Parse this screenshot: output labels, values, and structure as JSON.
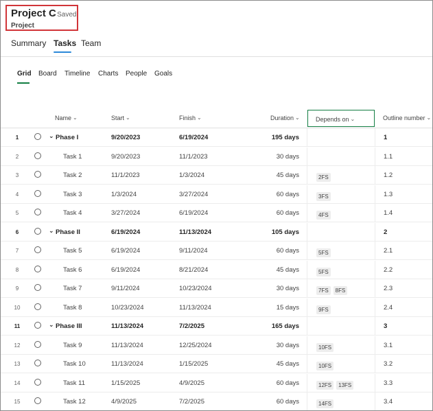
{
  "header": {
    "project_title": "Project C",
    "saved_status": "- Saved",
    "project_label": "Project"
  },
  "main_tabs": [
    {
      "label": "Summary"
    },
    {
      "label": "Tasks"
    },
    {
      "label": "Team"
    }
  ],
  "sub_tabs": [
    {
      "label": "Grid"
    },
    {
      "label": "Board"
    },
    {
      "label": "Timeline"
    },
    {
      "label": "Charts"
    },
    {
      "label": "People"
    },
    {
      "label": "Goals"
    }
  ],
  "columns": {
    "name": "Name",
    "start": "Start",
    "finish": "Finish",
    "duration": "Duration",
    "depends_on": "Depends on",
    "outline_number": "Outline number"
  },
  "rows": [
    {
      "num": "1",
      "name": "Phase I",
      "start": "9/20/2023",
      "finish": "6/19/2024",
      "duration": "195 days",
      "depends": [],
      "outline": "1",
      "phase": true
    },
    {
      "num": "2",
      "name": "Task 1",
      "start": "9/20/2023",
      "finish": "11/1/2023",
      "duration": "30 days",
      "depends": [],
      "outline": "1.1",
      "phase": false
    },
    {
      "num": "3",
      "name": "Task 2",
      "start": "11/1/2023",
      "finish": "1/3/2024",
      "duration": "45 days",
      "depends": [
        "2FS"
      ],
      "outline": "1.2",
      "phase": false
    },
    {
      "num": "4",
      "name": "Task 3",
      "start": "1/3/2024",
      "finish": "3/27/2024",
      "duration": "60 days",
      "depends": [
        "3FS"
      ],
      "outline": "1.3",
      "phase": false
    },
    {
      "num": "5",
      "name": "Task 4",
      "start": "3/27/2024",
      "finish": "6/19/2024",
      "duration": "60 days",
      "depends": [
        "4FS"
      ],
      "outline": "1.4",
      "phase": false
    },
    {
      "num": "6",
      "name": "Phase II",
      "start": "6/19/2024",
      "finish": "11/13/2024",
      "duration": "105 days",
      "depends": [],
      "outline": "2",
      "phase": true
    },
    {
      "num": "7",
      "name": "Task 5",
      "start": "6/19/2024",
      "finish": "9/11/2024",
      "duration": "60 days",
      "depends": [
        "5FS"
      ],
      "outline": "2.1",
      "phase": false
    },
    {
      "num": "8",
      "name": "Task 6",
      "start": "6/19/2024",
      "finish": "8/21/2024",
      "duration": "45 days",
      "depends": [
        "5FS"
      ],
      "outline": "2.2",
      "phase": false
    },
    {
      "num": "9",
      "name": "Task 7",
      "start": "9/11/2024",
      "finish": "10/23/2024",
      "duration": "30 days",
      "depends": [
        "7FS",
        "8FS"
      ],
      "outline": "2.3",
      "phase": false
    },
    {
      "num": "10",
      "name": "Task 8",
      "start": "10/23/2024",
      "finish": "11/13/2024",
      "duration": "15 days",
      "depends": [
        "9FS"
      ],
      "outline": "2.4",
      "phase": false
    },
    {
      "num": "11",
      "name": "Phase III",
      "start": "11/13/2024",
      "finish": "7/2/2025",
      "duration": "165 days",
      "depends": [],
      "outline": "3",
      "phase": true
    },
    {
      "num": "12",
      "name": "Task 9",
      "start": "11/13/2024",
      "finish": "12/25/2024",
      "duration": "30 days",
      "depends": [
        "10FS"
      ],
      "outline": "3.1",
      "phase": false
    },
    {
      "num": "13",
      "name": "Task 10",
      "start": "11/13/2024",
      "finish": "1/15/2025",
      "duration": "45 days",
      "depends": [
        "10FS"
      ],
      "outline": "3.2",
      "phase": false
    },
    {
      "num": "14",
      "name": "Task 11",
      "start": "1/15/2025",
      "finish": "4/9/2025",
      "duration": "60 days",
      "depends": [
        "12FS",
        "13FS"
      ],
      "outline": "3.3",
      "phase": false
    },
    {
      "num": "15",
      "name": "Task 12",
      "start": "4/9/2025",
      "finish": "7/2/2025",
      "duration": "60 days",
      "depends": [
        "14FS"
      ],
      "outline": "3.4",
      "phase": false
    }
  ],
  "colors": {
    "highlight_border": "#d13438",
    "tab_underline": "#2b88d8",
    "grid_accent": "#107c41"
  },
  "icons": {
    "expand": "chevron-down-icon",
    "task_complete": "circle-checkbox-icon"
  }
}
